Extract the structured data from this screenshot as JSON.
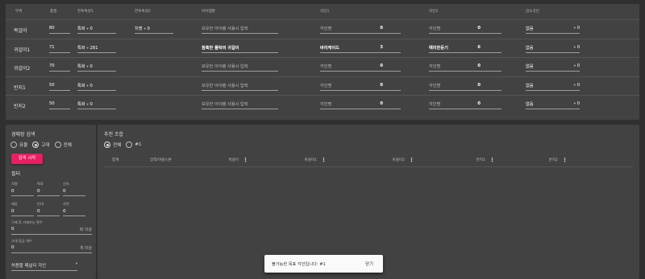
{
  "table": {
    "headers": {
      "slot": "부위",
      "quality": "품질",
      "bracelet1": "전투특성1",
      "bracelet2": "전투특성2",
      "item_name": "아이템명",
      "engrave1": "각인1",
      "engrave2": "각인2",
      "reduce": "감소각인"
    },
    "rows": [
      {
        "slot": "목걸이",
        "quality": "80",
        "stat1": "특화",
        "stat1_value": "0",
        "stat2": "치명",
        "stat2_value": "0",
        "item_name": "보유한 아이템 사용시 입력",
        "item_filled": false,
        "eng1_name": "각인명",
        "eng1_value": "0",
        "eng2_name": "각인명",
        "eng2_value": "0",
        "reduce_name": "없음",
        "reduce_value": "0"
      },
      {
        "slot": "귀걸이1",
        "quality": "71",
        "stat1": "특화",
        "stat1_value": "281",
        "stat2": "",
        "stat2_value": "",
        "item_name": "참혹한 몰락의 귀걸이",
        "item_filled": true,
        "eng1_name": "바리케이드",
        "eng1_value": "3",
        "eng2_name": "예리한둔기",
        "eng2_value": "6",
        "reduce_name": "없음",
        "reduce_value": "0"
      },
      {
        "slot": "귀걸이2",
        "quality": "70",
        "stat1": "특화",
        "stat1_value": "0",
        "stat2": "",
        "stat2_value": "",
        "item_name": "보유한 아이템 사용시 입력",
        "item_filled": false,
        "eng1_name": "각인명",
        "eng1_value": "0",
        "eng2_name": "각인명",
        "eng2_value": "0",
        "reduce_name": "없음",
        "reduce_value": "0"
      },
      {
        "slot": "반지1",
        "quality": "50",
        "stat1": "특화",
        "stat1_value": "0",
        "stat2": "",
        "stat2_value": "",
        "item_name": "보유한 아이템 사용시 입력",
        "item_filled": false,
        "eng1_name": "각인명",
        "eng1_value": "0",
        "eng2_name": "각인명",
        "eng2_value": "0",
        "reduce_name": "없음",
        "reduce_value": "0"
      },
      {
        "slot": "반지2",
        "quality": "50",
        "stat1": "특화",
        "stat1_value": "0",
        "stat2": "",
        "stat2_value": "",
        "item_name": "보유한 아이템 사용시 입력",
        "item_filled": false,
        "eng1_name": "각인명",
        "eng1_value": "0",
        "eng2_name": "각인명",
        "eng2_value": "0",
        "reduce_name": "없음",
        "reduce_value": "0"
      }
    ]
  },
  "search": {
    "title": "경매장 검색",
    "radio_options": [
      "유물",
      "고대",
      "전체"
    ],
    "selected_index": 1,
    "button_label": "검색 시작",
    "filter_title": "필터",
    "stats": [
      {
        "label": "치명",
        "value": "0"
      },
      {
        "label": "특화",
        "value": "0"
      },
      {
        "label": "신속",
        "value": "0"
      },
      {
        "label": "제압",
        "value": "0"
      },
      {
        "label": "인내",
        "value": "0"
      },
      {
        "label": "숙련",
        "value": "0"
      }
    ],
    "buy_count_label": "구매 후 거래가능 횟수",
    "buy_count_value": "0",
    "buy_count_suffix": "회 이상",
    "grade_label": "고대 등급 개수",
    "grade_value": "0",
    "grade_suffix": "개 이상",
    "penalty_label": "허용할 페널티 각인"
  },
  "recommend": {
    "title": "추천 조합",
    "radio_options": [
      "전체",
      "#1"
    ],
    "selected_index": 0,
    "columns": [
      "합계",
      "장착/이탈스톤",
      "목걸이",
      "귀걸이1",
      "귀걸이2",
      "반지1",
      "반지2"
    ]
  },
  "snackbar": {
    "message": "불가능한 목표 각인입니다: #1",
    "action": "닫기"
  }
}
